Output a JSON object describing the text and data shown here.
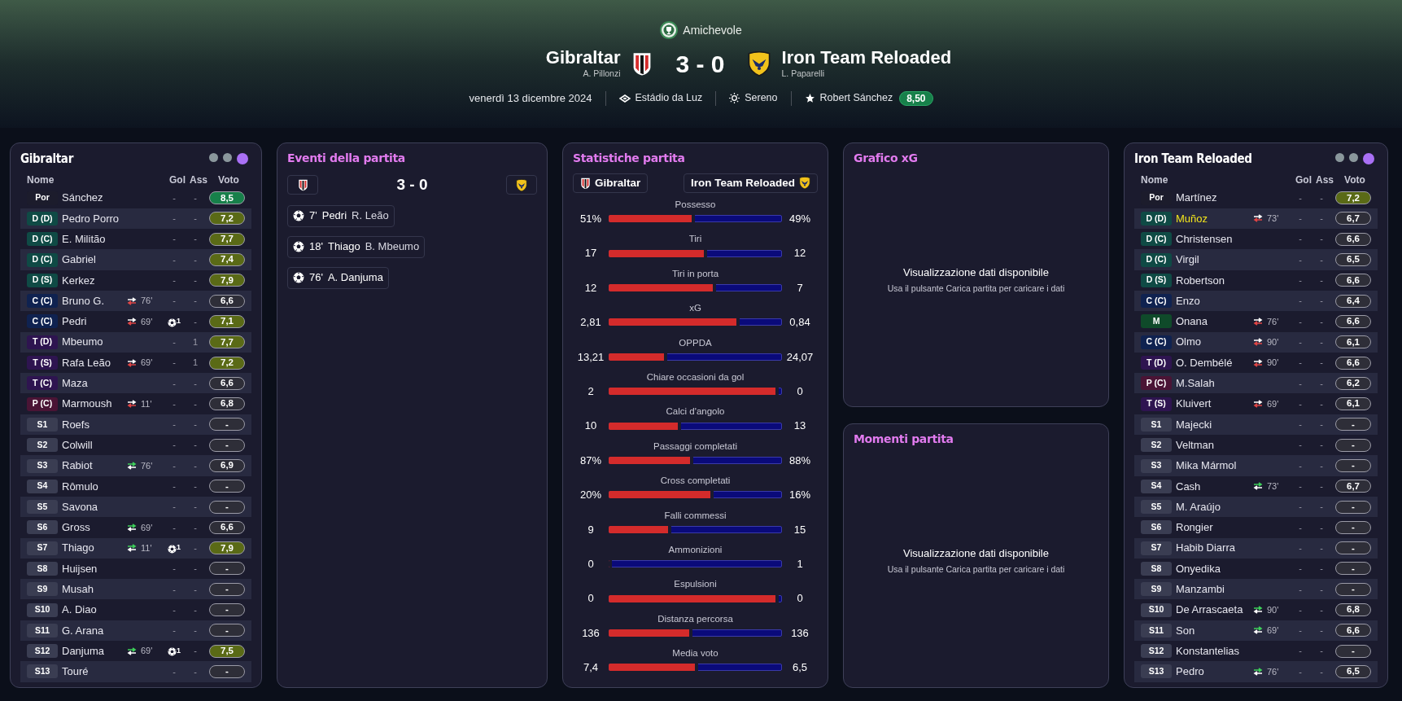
{
  "header": {
    "competition": "Amichevole",
    "home": {
      "name": "Gibraltar",
      "coach": "A. Pillonzi"
    },
    "score": "3 - 0",
    "away": {
      "name": "Iron Team Reloaded",
      "coach": "L. Paparelli"
    },
    "date": "venerdì 13 dicembre 2024",
    "stadium": "Estádio da Luz",
    "weather": "Sereno",
    "mvp": "Robert Sánchez",
    "mvp_rating": "8,50"
  },
  "home_panel": {
    "title": "Gibraltar",
    "view_dots": [
      {
        "selected": false
      },
      {
        "selected": false
      },
      {
        "selected": true
      }
    ],
    "columns": [
      "Nome",
      "Gol",
      "Ass",
      "Voto"
    ],
    "players": [
      {
        "pos": "Por",
        "color": "#1c1c2c",
        "name": "Sánchez",
        "highlighted": false,
        "gol": "-",
        "goal_icon": false,
        "ass": "-",
        "rating": {
          "text": "8,5",
          "color": "#17804a"
        }
      },
      {
        "pos": "D (D)",
        "color": "#0f4a45",
        "name": "Pedro Porro",
        "highlighted": false,
        "gol": "-",
        "goal_icon": false,
        "ass": "-",
        "rating": {
          "text": "7,2",
          "color": "#5a6a16"
        }
      },
      {
        "pos": "D (C)",
        "color": "#0f4a45",
        "name": "E. Militão",
        "highlighted": false,
        "gol": "-",
        "goal_icon": false,
        "ass": "-",
        "rating": {
          "text": "7,7",
          "color": "#5a6a16"
        }
      },
      {
        "pos": "D (C)",
        "color": "#0f4a45",
        "name": "Gabriel",
        "highlighted": false,
        "gol": "-",
        "goal_icon": false,
        "ass": "-",
        "rating": {
          "text": "7,4",
          "color": "#5a6a16"
        }
      },
      {
        "pos": "D (S)",
        "color": "#0f4a45",
        "name": "Kerkez",
        "highlighted": false,
        "gol": "-",
        "goal_icon": false,
        "ass": "-",
        "rating": {
          "text": "7,9",
          "color": "#5a6a16"
        }
      },
      {
        "pos": "C (C)",
        "color": "#0f2250",
        "name": "Bruno G.",
        "highlighted": false,
        "sub": {
          "kind": "off",
          "minute": "76'"
        },
        "gol": "-",
        "goal_icon": false,
        "ass": "-",
        "rating": {
          "text": "6,6",
          "color": "#2e2e38"
        }
      },
      {
        "pos": "C (C)",
        "color": "#0f2250",
        "name": "Pedri",
        "highlighted": false,
        "sub": {
          "kind": "off",
          "minute": "69'"
        },
        "gol": "1",
        "goal_icon": true,
        "ass": "-",
        "rating": {
          "text": "7,1",
          "color": "#5a6a16"
        }
      },
      {
        "pos": "T (D)",
        "color": "#2e1450",
        "name": "Mbeumo",
        "highlighted": false,
        "gol": "-",
        "goal_icon": false,
        "ass": "1",
        "rating": {
          "text": "7,7",
          "color": "#5a6a16"
        }
      },
      {
        "pos": "T (S)",
        "color": "#2e1450",
        "name": "Rafa Leão",
        "highlighted": false,
        "sub": {
          "kind": "off",
          "minute": "69'"
        },
        "gol": "-",
        "goal_icon": false,
        "ass": "1",
        "rating": {
          "text": "7,2",
          "color": "#5a6a16"
        }
      },
      {
        "pos": "T (C)",
        "color": "#2e1450",
        "name": "Maza",
        "highlighted": false,
        "gol": "-",
        "goal_icon": false,
        "ass": "-",
        "rating": {
          "text": "6,6",
          "color": "#2e2e38"
        }
      },
      {
        "pos": "P (C)",
        "color": "#4a1435",
        "name": "Marmoush",
        "highlighted": false,
        "sub": {
          "kind": "off",
          "minute": "11'"
        },
        "gol": "-",
        "goal_icon": false,
        "ass": "-",
        "rating": {
          "text": "6,8",
          "color": "#2e2e38"
        }
      },
      {
        "pos": "S1",
        "color": "#3a3d52",
        "name": "Roefs",
        "highlighted": false,
        "gol": "-",
        "goal_icon": false,
        "ass": "-",
        "rating": {
          "text": "-",
          "color": "#2e2e38"
        }
      },
      {
        "pos": "S2",
        "color": "#3a3d52",
        "name": "Colwill",
        "highlighted": false,
        "gol": "-",
        "goal_icon": false,
        "ass": "-",
        "rating": {
          "text": "-",
          "color": "#2e2e38"
        }
      },
      {
        "pos": "S3",
        "color": "#3a3d52",
        "name": "Rabiot",
        "highlighted": false,
        "sub": {
          "kind": "on",
          "minute": "76'"
        },
        "gol": "-",
        "goal_icon": false,
        "ass": "-",
        "rating": {
          "text": "6,9",
          "color": "#2e2e38"
        }
      },
      {
        "pos": "S4",
        "color": "#3a3d52",
        "name": "Rômulo",
        "highlighted": false,
        "gol": "-",
        "goal_icon": false,
        "ass": "-",
        "rating": {
          "text": "-",
          "color": "#2e2e38"
        }
      },
      {
        "pos": "S5",
        "color": "#3a3d52",
        "name": "Savona",
        "highlighted": false,
        "gol": "-",
        "goal_icon": false,
        "ass": "-",
        "rating": {
          "text": "-",
          "color": "#2e2e38"
        }
      },
      {
        "pos": "S6",
        "color": "#3a3d52",
        "name": "Gross",
        "highlighted": false,
        "sub": {
          "kind": "on",
          "minute": "69'"
        },
        "gol": "-",
        "goal_icon": false,
        "ass": "-",
        "rating": {
          "text": "6,6",
          "color": "#2e2e38"
        }
      },
      {
        "pos": "S7",
        "color": "#3a3d52",
        "name": "Thiago",
        "highlighted": false,
        "sub": {
          "kind": "on",
          "minute": "11'"
        },
        "gol": "1",
        "goal_icon": true,
        "ass": "-",
        "rating": {
          "text": "7,9",
          "color": "#5a6a16"
        }
      },
      {
        "pos": "S8",
        "color": "#3a3d52",
        "name": "Huijsen",
        "highlighted": false,
        "gol": "-",
        "goal_icon": false,
        "ass": "-",
        "rating": {
          "text": "-",
          "color": "#2e2e38"
        }
      },
      {
        "pos": "S9",
        "color": "#3a3d52",
        "name": "Musah",
        "highlighted": false,
        "gol": "-",
        "goal_icon": false,
        "ass": "-",
        "rating": {
          "text": "-",
          "color": "#2e2e38"
        }
      },
      {
        "pos": "S10",
        "color": "#3a3d52",
        "name": "A. Diao",
        "highlighted": false,
        "gol": "-",
        "goal_icon": false,
        "ass": "-",
        "rating": {
          "text": "-",
          "color": "#2e2e38"
        }
      },
      {
        "pos": "S11",
        "color": "#3a3d52",
        "name": "G. Arana",
        "highlighted": false,
        "gol": "-",
        "goal_icon": false,
        "ass": "-",
        "rating": {
          "text": "-",
          "color": "#2e2e38"
        }
      },
      {
        "pos": "S12",
        "color": "#3a3d52",
        "name": "Danjuma",
        "highlighted": false,
        "sub": {
          "kind": "on",
          "minute": "69'"
        },
        "gol": "1",
        "goal_icon": true,
        "ass": "-",
        "rating": {
          "text": "7,5",
          "color": "#5a6a16"
        }
      },
      {
        "pos": "S13",
        "color": "#3a3d52",
        "name": "Touré",
        "highlighted": false,
        "gol": "-",
        "goal_icon": false,
        "ass": "-",
        "rating": {
          "text": "-",
          "color": "#2e2e38"
        }
      }
    ]
  },
  "events_panel": {
    "title": "Eventi della partita",
    "score": "3 - 0",
    "events": [
      {
        "minute": "7'",
        "scorer": "Pedri",
        "assist": "R. Leão"
      },
      {
        "minute": "18'",
        "scorer": "Thiago",
        "assist": "B. Mbeumo"
      },
      {
        "minute": "76'",
        "scorer": "A. Danjuma"
      }
    ]
  },
  "stats_panel": {
    "title": "Statistiche partita",
    "home": "Gibraltar",
    "away": "Iron Team Reloaded",
    "stats": [
      {
        "name": "Possesso",
        "home": "51%",
        "away": "49%",
        "level": 0.5
      },
      {
        "name": "Tiri",
        "home": "17",
        "away": "12",
        "level": 0.575
      },
      {
        "name": "Tiri in porta",
        "home": "12",
        "away": "7",
        "level": 0.625
      },
      {
        "name": "xG",
        "home": "2,81",
        "away": "0,84",
        "level": 0.765
      },
      {
        "name": "OPPDA",
        "home": "13,21",
        "away": "24,07",
        "level": 0.34
      },
      {
        "name": "Chiare occasioni da gol",
        "home": "2",
        "away": "0",
        "level": 0.99
      },
      {
        "name": "Calci d'angolo",
        "home": "10",
        "away": "13",
        "level": 0.42
      },
      {
        "name": "Passaggi completati",
        "home": "87%",
        "away": "88%",
        "level": 0.495
      },
      {
        "name": "Cross completati",
        "home": "20%",
        "away": "16%",
        "level": 0.61
      },
      {
        "name": "Falli commessi",
        "home": "9",
        "away": "15",
        "level": 0.365
      },
      {
        "name": "Ammonizioni",
        "home": "0",
        "away": "1",
        "level": 0.02
      },
      {
        "name": "Espulsioni",
        "home": "0",
        "away": "0",
        "level": 0.99
      },
      {
        "name": "Distanza percorsa",
        "home": "136",
        "away": "136",
        "level": 0.49
      },
      {
        "name": "Media voto",
        "home": "7,4",
        "away": "6,5",
        "level": 0.52
      }
    ]
  },
  "xg_panel": {
    "title": "Grafico xG",
    "message": "Visualizzazione dati disponibile",
    "hint": "Usa il pulsante Carica partita per caricare i dati"
  },
  "moments_panel": {
    "title": "Momenti partita",
    "message": "Visualizzazione dati disponibile",
    "hint": "Usa il pulsante Carica partita per caricare i dati"
  },
  "away_panel": {
    "title": "Iron Team Reloaded",
    "view_dots": [
      {
        "selected": false
      },
      {
        "selected": false
      },
      {
        "selected": true
      }
    ],
    "columns": [
      "Nome",
      "Gol",
      "Ass",
      "Voto"
    ],
    "players": [
      {
        "pos": "Por",
        "color": "#1c1c2c",
        "name": "Martínez",
        "highlighted": false,
        "gol": "-",
        "goal_icon": false,
        "ass": "-",
        "rating": {
          "text": "7,2",
          "color": "#5a6a16"
        }
      },
      {
        "pos": "D (D)",
        "color": "#0f4a45",
        "name": "Muñoz",
        "highlighted": true,
        "sub": {
          "kind": "off",
          "minute": "73'"
        },
        "gol": "-",
        "goal_icon": false,
        "ass": "-",
        "rating": {
          "text": "6,7",
          "color": "#2e2e38"
        }
      },
      {
        "pos": "D (C)",
        "color": "#0f4a45",
        "name": "Christensen",
        "highlighted": false,
        "gol": "-",
        "goal_icon": false,
        "ass": "-",
        "rating": {
          "text": "6,6",
          "color": "#2e2e38"
        }
      },
      {
        "pos": "D (C)",
        "color": "#0f4a45",
        "name": "Virgil",
        "highlighted": false,
        "gol": "-",
        "goal_icon": false,
        "ass": "-",
        "rating": {
          "text": "6,5",
          "color": "#2e2e38"
        }
      },
      {
        "pos": "D (S)",
        "color": "#0f4a45",
        "name": "Robertson",
        "highlighted": false,
        "gol": "-",
        "goal_icon": false,
        "ass": "-",
        "rating": {
          "text": "6,6",
          "color": "#2e2e38"
        }
      },
      {
        "pos": "C (C)",
        "color": "#0f2250",
        "name": "Enzo",
        "highlighted": false,
        "gol": "-",
        "goal_icon": false,
        "ass": "-",
        "rating": {
          "text": "6,4",
          "color": "#2e2e38"
        }
      },
      {
        "pos": "M",
        "color": "#0f4a2a",
        "name": "Onana",
        "highlighted": false,
        "sub": {
          "kind": "off",
          "minute": "76'"
        },
        "gol": "-",
        "goal_icon": false,
        "ass": "-",
        "rating": {
          "text": "6,6",
          "color": "#2e2e38"
        }
      },
      {
        "pos": "C (C)",
        "color": "#0f2250",
        "name": "Olmo",
        "highlighted": false,
        "sub": {
          "kind": "off",
          "minute": "90'"
        },
        "gol": "-",
        "goal_icon": false,
        "ass": "-",
        "rating": {
          "text": "6,1",
          "color": "#2e2e38"
        }
      },
      {
        "pos": "T (D)",
        "color": "#2e1450",
        "name": "O. Dembélé",
        "highlighted": false,
        "sub": {
          "kind": "off",
          "minute": "90'"
        },
        "gol": "-",
        "goal_icon": false,
        "ass": "-",
        "rating": {
          "text": "6,6",
          "color": "#2e2e38"
        }
      },
      {
        "pos": "P (C)",
        "color": "#4a1435",
        "name": "M.Salah",
        "highlighted": false,
        "gol": "-",
        "goal_icon": false,
        "ass": "-",
        "rating": {
          "text": "6,2",
          "color": "#2e2e38"
        }
      },
      {
        "pos": "T (S)",
        "color": "#2e1450",
        "name": "Kluivert",
        "highlighted": false,
        "sub": {
          "kind": "off",
          "minute": "69'"
        },
        "gol": "-",
        "goal_icon": false,
        "ass": "-",
        "rating": {
          "text": "6,1",
          "color": "#2e2e38"
        }
      },
      {
        "pos": "S1",
        "color": "#3a3d52",
        "name": "Majecki",
        "highlighted": false,
        "gol": "-",
        "goal_icon": false,
        "ass": "-",
        "rating": {
          "text": "-",
          "color": "#2e2e38"
        }
      },
      {
        "pos": "S2",
        "color": "#3a3d52",
        "name": "Veltman",
        "highlighted": false,
        "gol": "-",
        "goal_icon": false,
        "ass": "-",
        "rating": {
          "text": "-",
          "color": "#2e2e38"
        }
      },
      {
        "pos": "S3",
        "color": "#3a3d52",
        "name": "Mika Mármol",
        "highlighted": false,
        "gol": "-",
        "goal_icon": false,
        "ass": "-",
        "rating": {
          "text": "-",
          "color": "#2e2e38"
        }
      },
      {
        "pos": "S4",
        "color": "#3a3d52",
        "name": "Cash",
        "highlighted": false,
        "sub": {
          "kind": "on",
          "minute": "73'"
        },
        "gol": "-",
        "goal_icon": false,
        "ass": "-",
        "rating": {
          "text": "6,7",
          "color": "#2e2e38"
        }
      },
      {
        "pos": "S5",
        "color": "#3a3d52",
        "name": "M. Araújo",
        "highlighted": false,
        "gol": "-",
        "goal_icon": false,
        "ass": "-",
        "rating": {
          "text": "-",
          "color": "#2e2e38"
        }
      },
      {
        "pos": "S6",
        "color": "#3a3d52",
        "name": "Rongier",
        "highlighted": false,
        "gol": "-",
        "goal_icon": false,
        "ass": "-",
        "rating": {
          "text": "-",
          "color": "#2e2e38"
        }
      },
      {
        "pos": "S7",
        "color": "#3a3d52",
        "name": "Habib Diarra",
        "highlighted": false,
        "gol": "-",
        "goal_icon": false,
        "ass": "-",
        "rating": {
          "text": "-",
          "color": "#2e2e38"
        }
      },
      {
        "pos": "S8",
        "color": "#3a3d52",
        "name": "Onyedika",
        "highlighted": false,
        "gol": "-",
        "goal_icon": false,
        "ass": "-",
        "rating": {
          "text": "-",
          "color": "#2e2e38"
        }
      },
      {
        "pos": "S9",
        "color": "#3a3d52",
        "name": "Manzambi",
        "highlighted": false,
        "gol": "-",
        "goal_icon": false,
        "ass": "-",
        "rating": {
          "text": "-",
          "color": "#2e2e38"
        }
      },
      {
        "pos": "S10",
        "color": "#3a3d52",
        "name": "De Arrascaeta",
        "highlighted": false,
        "sub": {
          "kind": "on",
          "minute": "90'"
        },
        "gol": "-",
        "goal_icon": false,
        "ass": "-",
        "rating": {
          "text": "6,8",
          "color": "#2e2e38"
        }
      },
      {
        "pos": "S11",
        "color": "#3a3d52",
        "name": "Son",
        "highlighted": false,
        "sub": {
          "kind": "on",
          "minute": "69'"
        },
        "gol": "-",
        "goal_icon": false,
        "ass": "-",
        "rating": {
          "text": "6,6",
          "color": "#2e2e38"
        }
      },
      {
        "pos": "S12",
        "color": "#3a3d52",
        "name": "Konstantelias",
        "highlighted": false,
        "gol": "-",
        "goal_icon": false,
        "ass": "-",
        "rating": {
          "text": "-",
          "color": "#2e2e38"
        }
      },
      {
        "pos": "S13",
        "color": "#3a3d52",
        "name": "Pedro",
        "highlighted": false,
        "sub": {
          "kind": "on",
          "minute": "76'"
        },
        "gol": "-",
        "goal_icon": false,
        "ass": "-",
        "rating": {
          "text": "6,5",
          "color": "#2e2e38"
        }
      }
    ]
  }
}
